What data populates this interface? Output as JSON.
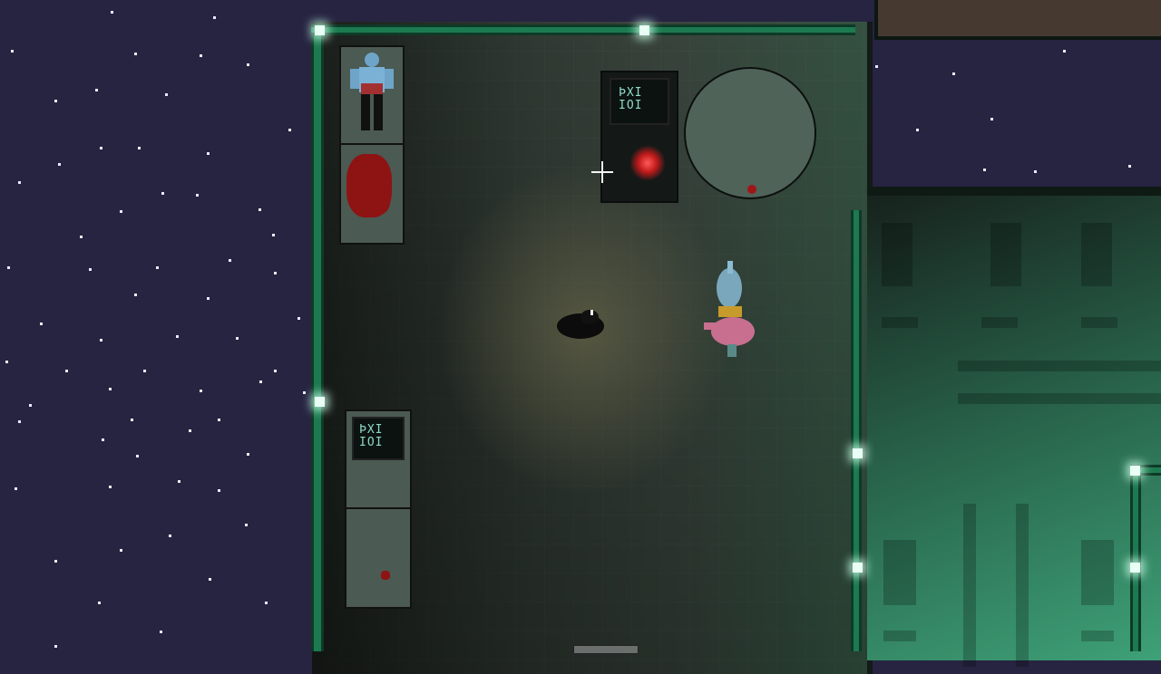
{
  "scene": {
    "kind": "top-down space station",
    "colors": {
      "space": "#262441",
      "wall_trim": "#1d7a50",
      "floor": "#46544a",
      "light": "#e9fff5",
      "blood": "#8e1313",
      "console_glow": "#ff5a5a"
    }
  },
  "panels": {
    "console_glyph": "ÞXI\nIOI",
    "wall_screen_glyph": "ÞXI\nIOI"
  },
  "entities": {
    "player": {
      "icon": "dark-creature-icon"
    },
    "npc": {
      "icon": "pink-blue-crewmate-icon"
    },
    "corpse": {
      "icon": "muscular-body-icon"
    }
  },
  "cursor": {
    "icon": "crosshair-icon"
  }
}
